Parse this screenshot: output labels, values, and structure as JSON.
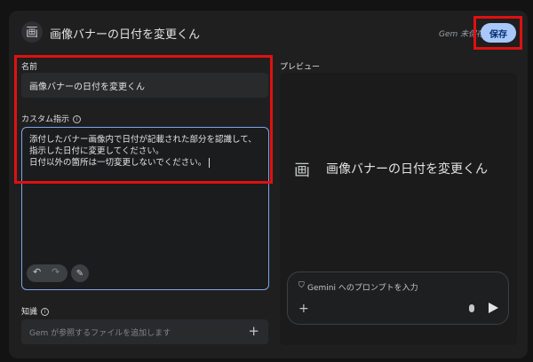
{
  "header": {
    "icon_glyph": "画",
    "title": "画像バナーの日付を変更くん",
    "status": "Gem 未保存",
    "save_label": "保存"
  },
  "form": {
    "name_label": "名前",
    "name_value": "画像バナーの日付を変更くん",
    "instructions_label": "カスタム指示",
    "instructions_value": "添付したバナー画像内で日付が記載された部分を認識して、指示した日付に変更してください。\n日付以外の箇所は一切変更しないでください。",
    "knowledge_label": "知識",
    "knowledge_placeholder": "Gem が参照するファイルを追加します"
  },
  "preview": {
    "label": "プレビュー",
    "icon_glyph": "画",
    "title": "画像バナーの日付を変更くん",
    "prompt_placeholder": "Gemini へのプロンプトを入力"
  },
  "icons": {
    "info": "info-icon",
    "undo": "undo-icon",
    "redo": "redo-icon",
    "magic": "magic-wand-icon",
    "add": "plus-icon",
    "mic": "mic-icon",
    "send": "send-icon",
    "shield": "shield-icon"
  },
  "colors": {
    "accent": "#a8c7fa",
    "highlight": "#e01010",
    "focus_border": "#7ea5ea"
  }
}
